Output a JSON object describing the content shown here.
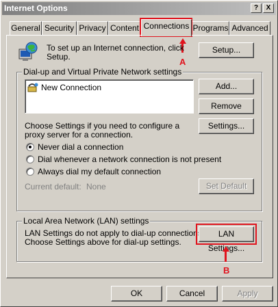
{
  "window": {
    "title": "Internet Options",
    "help_btn": "?",
    "close_btn": "X"
  },
  "tabs": [
    {
      "label": "General",
      "underline": "G",
      "rest": "eneral"
    },
    {
      "label": "Security",
      "underline": "",
      "rest": "Security"
    },
    {
      "label": "Privacy",
      "underline": "",
      "rest": "Privacy"
    },
    {
      "label": "Content",
      "underline": "",
      "rest": "Content"
    },
    {
      "label": "Connections",
      "underline": "",
      "rest": "Connections"
    },
    {
      "label": "Programs",
      "underline": "",
      "rest": "Programs"
    },
    {
      "label": "Advanced",
      "underline": "",
      "rest": "Advanced"
    }
  ],
  "active_tab": "Connections",
  "setup": {
    "text": "To set up an Internet connection, click Setup.",
    "button": "Setup...",
    "icon": "globe-computer-icon"
  },
  "dialup": {
    "group_label": "Dial-up and Virtual Private Network settings",
    "connections": [
      {
        "name": "New Connection",
        "icon": "phone-connection-icon"
      }
    ],
    "add_button": "Add...",
    "remove_button": "Remove",
    "settings_text": "Choose Settings if you need to configure a proxy server for a connection.",
    "settings_button": "Settings...",
    "radios": [
      {
        "label": "Never dial a connection",
        "checked": true
      },
      {
        "label": "Dial whenever a network connection is not present",
        "checked": false
      },
      {
        "label": "Always dial my default connection",
        "checked": false
      }
    ],
    "current_default_label": "Current default:",
    "current_default_value": "None",
    "set_default_button": "Set Default"
  },
  "lan": {
    "group_label": "Local Area Network (LAN) settings",
    "text_line1": "LAN Settings do not apply to dial-up connections.",
    "text_line2": "Choose Settings above for dial-up settings.",
    "button": "LAN Settings..."
  },
  "footer": {
    "ok": "OK",
    "cancel": "Cancel",
    "apply": "Apply"
  },
  "annotations": [
    {
      "letter": "A",
      "target": "Connections",
      "color": "#e0141e"
    },
    {
      "letter": "B",
      "target": "LAN Settings...",
      "color": "#e0141e"
    }
  ]
}
